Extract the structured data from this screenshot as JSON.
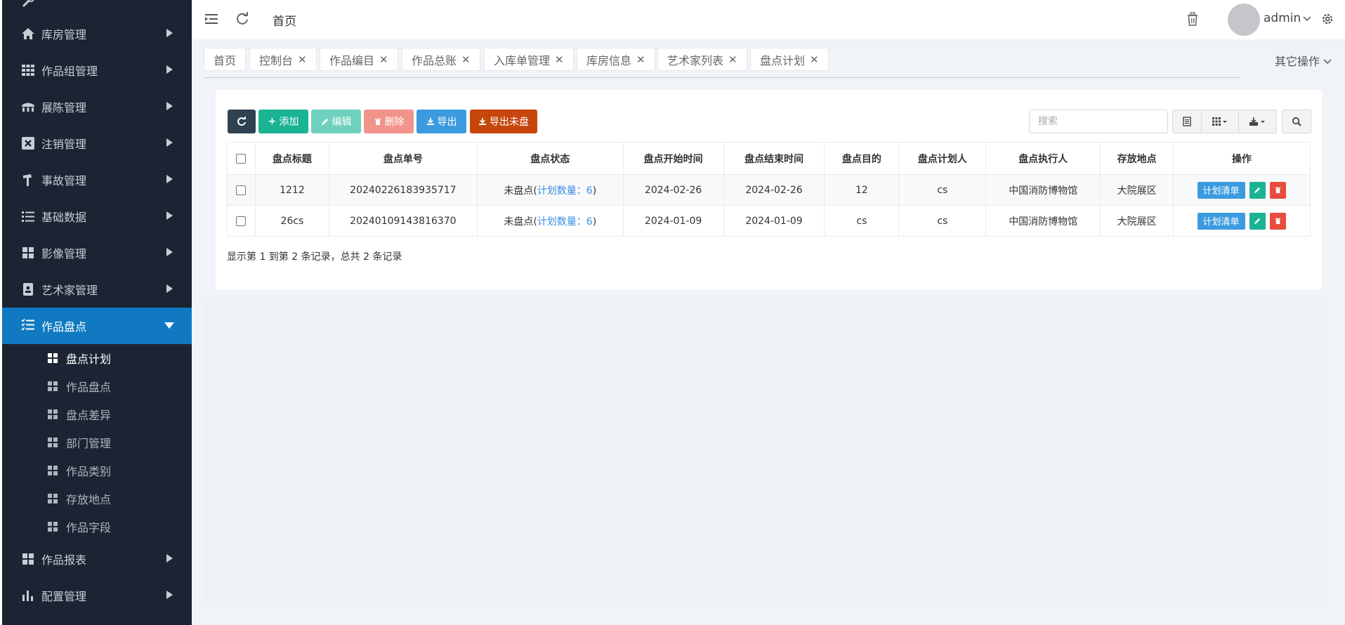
{
  "sidebar": {
    "items": [
      {
        "label": "库房管理",
        "icon": "home-icon"
      },
      {
        "label": "作品组管理",
        "icon": "grid-icon"
      },
      {
        "label": "展陈管理",
        "icon": "exhibit-icon"
      },
      {
        "label": "注销管理",
        "icon": "cancel-icon"
      },
      {
        "label": "事故管理",
        "icon": "alert-icon"
      },
      {
        "label": "基础数据",
        "icon": "list-icon"
      },
      {
        "label": "影像管理",
        "icon": "image-grid-icon"
      },
      {
        "label": "艺术家管理",
        "icon": "id-card-icon"
      },
      {
        "label": "作品盘点",
        "icon": "checklist-icon",
        "active": true
      },
      {
        "label": "作品报表",
        "icon": "report-icon"
      },
      {
        "label": "配置管理",
        "icon": "chart-icon"
      }
    ],
    "subitems": [
      {
        "label": "盘点计划",
        "current": true
      },
      {
        "label": "作品盘点"
      },
      {
        "label": "盘点差异"
      },
      {
        "label": "部门管理"
      },
      {
        "label": "作品类别"
      },
      {
        "label": "存放地点"
      },
      {
        "label": "作品字段"
      }
    ],
    "colors": {
      "bg": "#1c2433",
      "active": "#1179c2"
    }
  },
  "topbar": {
    "breadcrumb": "首页",
    "user": "admin"
  },
  "tabs": [
    {
      "label": "首页",
      "closable": false
    },
    {
      "label": "控制台",
      "closable": true
    },
    {
      "label": "作品编目",
      "closable": true
    },
    {
      "label": "作品总账",
      "closable": true
    },
    {
      "label": "入库单管理",
      "closable": true
    },
    {
      "label": "库房信息",
      "closable": true
    },
    {
      "label": "艺术家列表",
      "closable": true
    },
    {
      "label": "盘点计划",
      "closable": true
    }
  ],
  "other_ops": "其它操作",
  "toolbar": {
    "add": "添加",
    "edit": "编辑",
    "delete": "删除",
    "export": "导出",
    "export_unchecked": "导出未盘",
    "search_placeholder": "搜索",
    "colors": {
      "refresh": "#2f4050",
      "add": "#1ab394",
      "edit": "#6fd1bd",
      "delete": "#f0948c",
      "export": "#3c9be0",
      "export_unchecked": "#c6460c"
    }
  },
  "table": {
    "headers": [
      "盘点标题",
      "盘点单号",
      "盘点状态",
      "盘点开始时间",
      "盘点结束时间",
      "盘点目的",
      "盘点计划人",
      "盘点执行人",
      "存放地点",
      "操作"
    ],
    "rows": [
      {
        "title": "1212",
        "number": "20240226183935717",
        "status": "未盘点",
        "plan_label": "计划数量：",
        "plan_count": "6",
        "start": "2024-02-26",
        "end": "2024-02-26",
        "purpose": "12",
        "planner": "cs",
        "executor": "中国消防博物馆",
        "location": "大院展区"
      },
      {
        "title": "26cs",
        "number": "20240109143816370",
        "status": "未盘点",
        "plan_label": "计划数量：",
        "plan_count": "6",
        "start": "2024-01-09",
        "end": "2024-01-09",
        "purpose": "cs",
        "planner": "cs",
        "executor": "中国消防博物馆",
        "location": "大院展区"
      }
    ],
    "op_plan_list": "计划清单"
  },
  "summary": "显示第 1 到第 2 条记录，总共 2 条记录"
}
